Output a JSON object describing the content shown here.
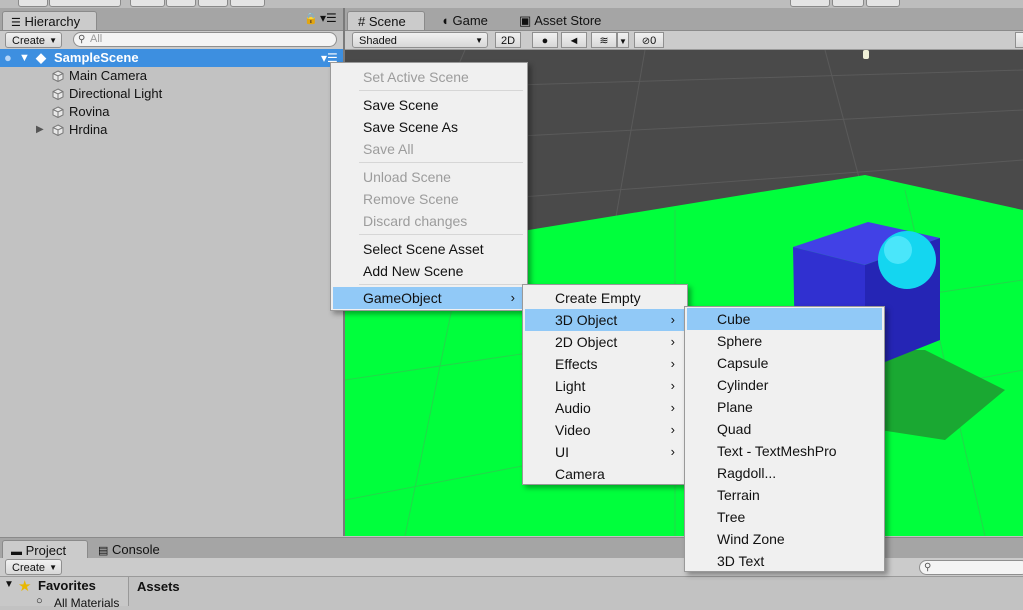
{
  "hierarchy": {
    "tab_label": "Hierarchy",
    "create_label": "Create",
    "search_placeholder": "All",
    "scene_name": "SampleScene",
    "items": [
      {
        "label": "Main Camera"
      },
      {
        "label": "Directional Light"
      },
      {
        "label": "Rovina"
      },
      {
        "label": "Hrdina"
      }
    ]
  },
  "scene_view": {
    "tabs": [
      {
        "label": "Scene",
        "icon": "hash-icon"
      },
      {
        "label": "Game",
        "icon": "pacman-icon"
      },
      {
        "label": "Asset Store",
        "icon": "bag-icon"
      }
    ],
    "shading_mode": "Shaded",
    "mode_2d": "2D",
    "hidden_count": "0",
    "colors": {
      "ground": "#00ff3c",
      "cube": "#3131d6",
      "sphere": "#14d6f0",
      "sky": "#4a4a4a"
    }
  },
  "context_menu": {
    "items": [
      {
        "label": "Set Active Scene",
        "disabled": true
      },
      {
        "label": "Save Scene"
      },
      {
        "label": "Save Scene As"
      },
      {
        "label": "Save All",
        "disabled": true
      },
      {
        "label": "Unload Scene",
        "disabled": true
      },
      {
        "label": "Remove Scene",
        "disabled": true
      },
      {
        "label": "Discard changes",
        "disabled": true
      },
      {
        "label": "Select Scene Asset"
      },
      {
        "label": "Add New Scene"
      },
      {
        "label": "GameObject",
        "submenu": true,
        "highlighted": true
      }
    ]
  },
  "gameobject_menu": {
    "items": [
      {
        "label": "Create Empty"
      },
      {
        "label": "3D Object",
        "submenu": true,
        "highlighted": true
      },
      {
        "label": "2D Object",
        "submenu": true
      },
      {
        "label": "Effects",
        "submenu": true
      },
      {
        "label": "Light",
        "submenu": true
      },
      {
        "label": "Audio",
        "submenu": true
      },
      {
        "label": "Video",
        "submenu": true
      },
      {
        "label": "UI",
        "submenu": true
      },
      {
        "label": "Camera"
      }
    ]
  },
  "object3d_menu": {
    "items": [
      {
        "label": "Cube",
        "highlighted": true
      },
      {
        "label": "Sphere"
      },
      {
        "label": "Capsule"
      },
      {
        "label": "Cylinder"
      },
      {
        "label": "Plane"
      },
      {
        "label": "Quad"
      },
      {
        "label": "Text - TextMeshPro"
      },
      {
        "label": "Ragdoll..."
      },
      {
        "label": "Terrain"
      },
      {
        "label": "Tree"
      },
      {
        "label": "Wind Zone"
      },
      {
        "label": "3D Text"
      }
    ]
  },
  "project": {
    "tabs": [
      {
        "label": "Project",
        "icon": "folder-icon"
      },
      {
        "label": "Console",
        "icon": "console-icon"
      }
    ],
    "create_label": "Create",
    "favorites_label": "Favorites",
    "all_materials_label": "All Materials",
    "assets_label": "Assets"
  }
}
